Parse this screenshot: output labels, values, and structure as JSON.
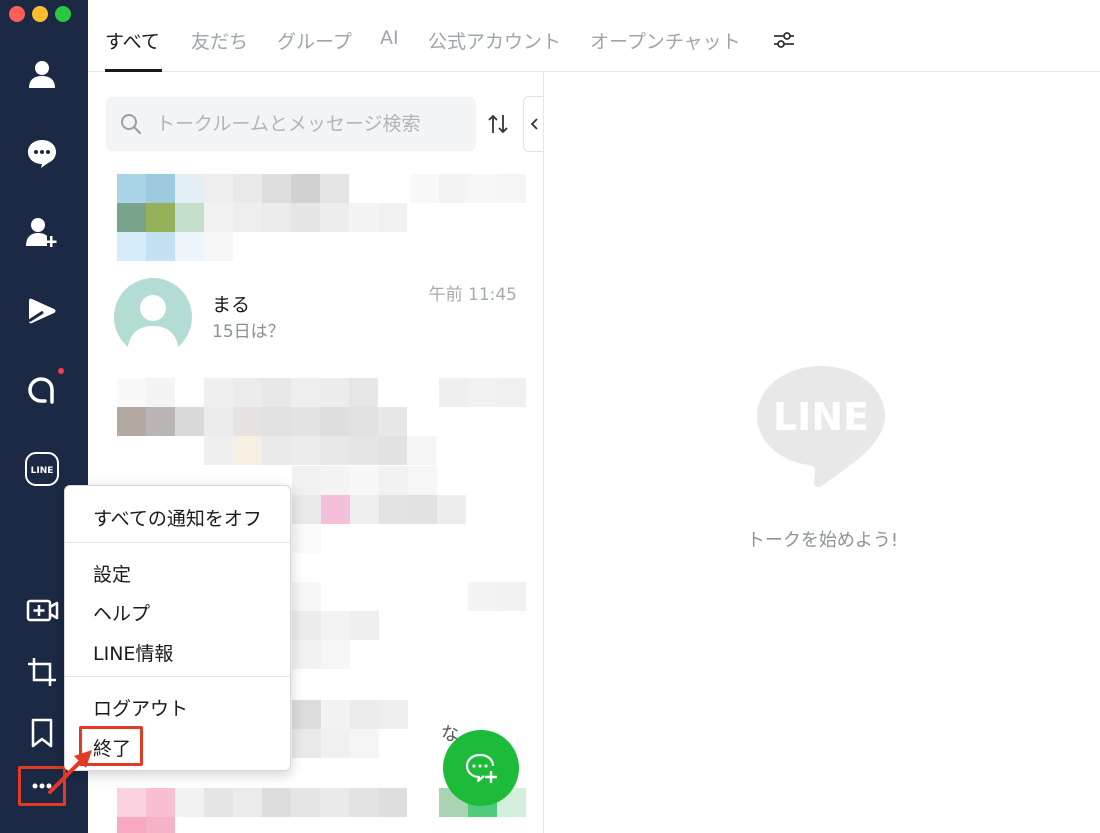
{
  "window": {
    "traffic_lights": [
      "close",
      "minimize",
      "zoom"
    ]
  },
  "sidebar": {
    "items": [
      {
        "name": "friends",
        "icon": "person-icon"
      },
      {
        "name": "chats",
        "icon": "chat-bubble-icon"
      },
      {
        "name": "add-friends",
        "icon": "add-person-icon"
      },
      {
        "name": "voom",
        "icon": "play-icon"
      },
      {
        "name": "news",
        "icon": "a-icon",
        "has_notification": true
      },
      {
        "name": "line-service",
        "icon": "line-badge-icon",
        "label": "LINE"
      },
      {
        "name": "video-call",
        "icon": "video-plus-icon"
      },
      {
        "name": "screenshot",
        "icon": "crop-icon"
      },
      {
        "name": "keep",
        "icon": "bookmark-icon"
      },
      {
        "name": "more",
        "icon": "more-dots-icon"
      }
    ],
    "accent": "#1c2945"
  },
  "tabs": [
    {
      "label": "すべて",
      "active": true
    },
    {
      "label": "友だち"
    },
    {
      "label": "グループ"
    },
    {
      "label": "AI"
    },
    {
      "label": "公式アカウント"
    },
    {
      "label": "オープンチャット"
    }
  ],
  "search": {
    "placeholder": "トークルームとメッセージ検索",
    "value": ""
  },
  "chat_list": [
    {
      "name": "まる",
      "preview": "15日は？",
      "time": "午前 11:45"
    }
  ],
  "stray_text": {
    "na": "な"
  },
  "right_pane": {
    "logo_text": "LINE",
    "empty_message": "トークを始めよう!"
  },
  "menu": {
    "items": [
      {
        "label": "すべての通知をオフ"
      },
      {
        "label": "設定"
      },
      {
        "label": "ヘルプ"
      },
      {
        "label": "LINE情報"
      },
      {
        "label": "ログアウト"
      },
      {
        "label": "終了",
        "highlighted": true
      }
    ]
  },
  "colors": {
    "line_green": "#1dbb3a",
    "highlight_red": "#e23a25",
    "notification_dot": "#ff3b4e"
  }
}
